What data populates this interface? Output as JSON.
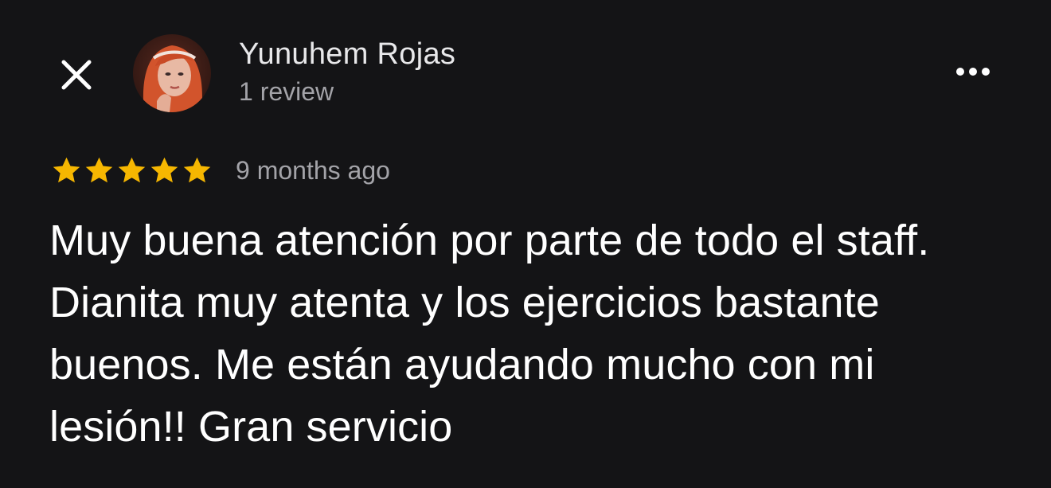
{
  "header": {
    "close_icon": "close-icon",
    "author_name": "Yunuhem Rojas",
    "review_count": "1 review",
    "more_icon": "more-horizontal-icon"
  },
  "review": {
    "rating": 5,
    "rating_max": 5,
    "star_color": "#f6b701",
    "date": "9 months ago",
    "text": "Muy buena atención por parte de todo el staff. Dianita muy atenta y los ejercicios bastante buenos. Me están ayudando mucho con mi lesión!! Gran servicio"
  },
  "colors": {
    "background": "#141416",
    "primary_text": "#ffffff",
    "secondary_text": "#a3a3a8"
  }
}
